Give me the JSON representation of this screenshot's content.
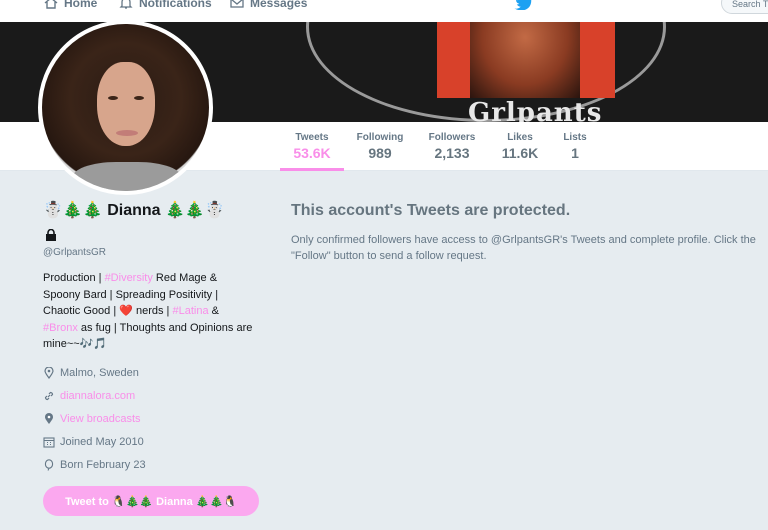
{
  "nav": {
    "home": "Home",
    "notifications": "Notifications",
    "messages": "Messages",
    "search_placeholder": "Search Twitter"
  },
  "banner": {
    "text": "Grlpants"
  },
  "stats": [
    {
      "label": "Tweets",
      "value": "53.6K"
    },
    {
      "label": "Following",
      "value": "989"
    },
    {
      "label": "Followers",
      "value": "2,133"
    },
    {
      "label": "Likes",
      "value": "11.6K"
    },
    {
      "label": "Lists",
      "value": "1"
    }
  ],
  "profile": {
    "name": "☃️🎄🎄 Dianna 🎄🎄☃️",
    "handle": "@GrlpantsGR",
    "bio": {
      "p1": "Production | ",
      "tag1": "#Diversity",
      "p2": " Red Mage & Spoony Bard | Spreading Positivity | Chaotic Good | ❤️ nerds | ",
      "tag2": "#Latina",
      "p3": " & ",
      "tag3": "#Bronx",
      "p4": " as fug | Thoughts and Opinions are mine~~🎶🎵"
    },
    "location": "Malmo, Sweden",
    "website": "diannalora.com",
    "broadcasts": "View broadcasts",
    "joined": "Joined May 2010",
    "born": "Born February 23",
    "tweet_button": "Tweet to 🐧🎄🎄 Dianna 🎄🎄🐧"
  },
  "protected": {
    "title": "This account's Tweets are protected.",
    "description": "Only confirmed followers have access to @GrlpantsGR's Tweets and complete profile. Click the \"Follow\" button to send a follow request."
  },
  "colors": {
    "accent": "#f98ee9",
    "button": "#fba8ef",
    "background": "#e6ecf0"
  }
}
